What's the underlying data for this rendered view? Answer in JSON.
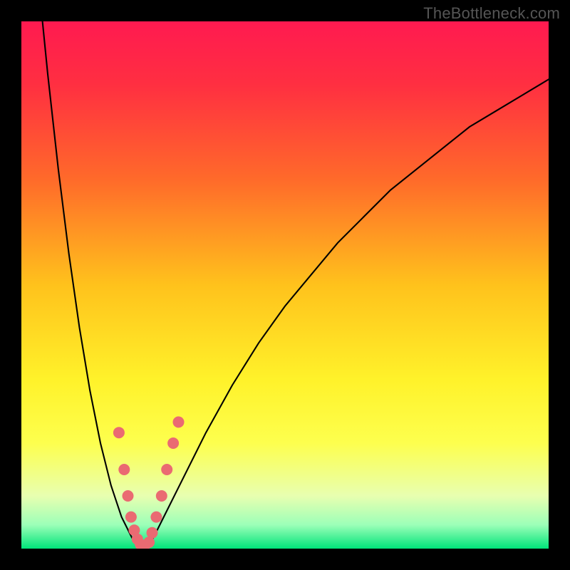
{
  "watermark": "TheBottleneck.com",
  "chart_data": {
    "type": "line",
    "title": "",
    "xlabel": "",
    "ylabel": "",
    "xlim": [
      0,
      100
    ],
    "ylim": [
      0,
      100
    ],
    "background_gradient": {
      "stops": [
        {
          "offset": 0.0,
          "color": "#ff1a50"
        },
        {
          "offset": 0.12,
          "color": "#ff2f41"
        },
        {
          "offset": 0.3,
          "color": "#ff6a2a"
        },
        {
          "offset": 0.5,
          "color": "#ffc21c"
        },
        {
          "offset": 0.68,
          "color": "#fff22a"
        },
        {
          "offset": 0.8,
          "color": "#fdff4e"
        },
        {
          "offset": 0.9,
          "color": "#e8ffb0"
        },
        {
          "offset": 0.955,
          "color": "#9cffb8"
        },
        {
          "offset": 1.0,
          "color": "#00e47a"
        }
      ]
    },
    "series": [
      {
        "name": "bottleneck-curve",
        "stroke": "#000000",
        "stroke_width": 2.1,
        "x": [
          4,
          5,
          6,
          7,
          8,
          9,
          10,
          11,
          12,
          13,
          14,
          15,
          16,
          17,
          18,
          19,
          20,
          21,
          22,
          23,
          24,
          25,
          27,
          30,
          35,
          40,
          45,
          50,
          55,
          60,
          65,
          70,
          75,
          80,
          85,
          90,
          95,
          100
        ],
        "values": [
          100,
          90,
          81,
          72,
          64,
          56,
          49,
          42,
          36,
          30,
          25,
          20,
          16,
          12,
          9,
          6,
          4,
          2,
          0.8,
          0.2,
          0.6,
          2,
          6,
          12,
          22,
          31,
          39,
          46,
          52,
          58,
          63,
          68,
          72,
          76,
          80,
          83,
          86,
          89
        ]
      }
    ],
    "markers": {
      "name": "highlighted-points",
      "color": "#ea6a72",
      "radius_px": 8,
      "points": [
        {
          "x": 18.5,
          "y": 22
        },
        {
          "x": 19.5,
          "y": 15
        },
        {
          "x": 20.2,
          "y": 10
        },
        {
          "x": 20.8,
          "y": 6
        },
        {
          "x": 21.4,
          "y": 3.5
        },
        {
          "x": 22.0,
          "y": 1.8
        },
        {
          "x": 22.6,
          "y": 0.8
        },
        {
          "x": 23.3,
          "y": 0.4
        },
        {
          "x": 24.2,
          "y": 1.2
        },
        {
          "x": 24.8,
          "y": 3
        },
        {
          "x": 25.6,
          "y": 6
        },
        {
          "x": 26.6,
          "y": 10
        },
        {
          "x": 27.6,
          "y": 15
        },
        {
          "x": 28.8,
          "y": 20
        },
        {
          "x": 29.8,
          "y": 24
        }
      ]
    }
  }
}
